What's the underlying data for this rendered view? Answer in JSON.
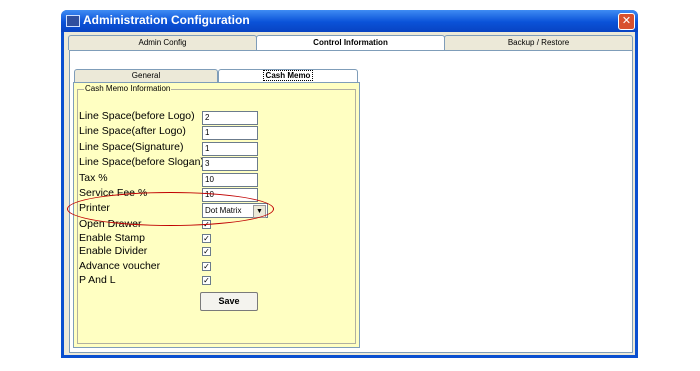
{
  "window": {
    "title": "Administration Configuration",
    "close_glyph": "✕"
  },
  "tabs": [
    {
      "label": "Admin Config"
    },
    {
      "label": "Control Information"
    },
    {
      "label": "Backup / Restore"
    }
  ],
  "subtabs": [
    {
      "label": "General"
    },
    {
      "label": "Cash Memo"
    }
  ],
  "group": {
    "title": "Cash Memo Information"
  },
  "fields": [
    {
      "label": "Line Space(before Logo)",
      "value": "2"
    },
    {
      "label": "Line Space(after Logo)",
      "value": "1"
    },
    {
      "label": "Line Space(Signature)",
      "value": "1"
    },
    {
      "label": "Line Space(before Slogan)",
      "value": "3"
    },
    {
      "label": "Tax %",
      "value": "10"
    },
    {
      "label": "Service Fee %",
      "value": "10"
    }
  ],
  "printer": {
    "label": "Printer",
    "selected": "Dot Matrix",
    "arrow": "▼"
  },
  "checks": [
    {
      "label": "Open Drawer",
      "mark": "✓"
    },
    {
      "label": "Enable Stamp",
      "mark": "✓"
    },
    {
      "label": "Enable Divider",
      "mark": "✓"
    },
    {
      "label": "Advance voucher",
      "mark": "✓"
    },
    {
      "label": "P And L",
      "mark": "✓"
    }
  ],
  "save_label": "Save",
  "colors": {
    "titlebar": "#0a52d8",
    "pane": "#ffffc2",
    "highlight": "#c00000"
  }
}
